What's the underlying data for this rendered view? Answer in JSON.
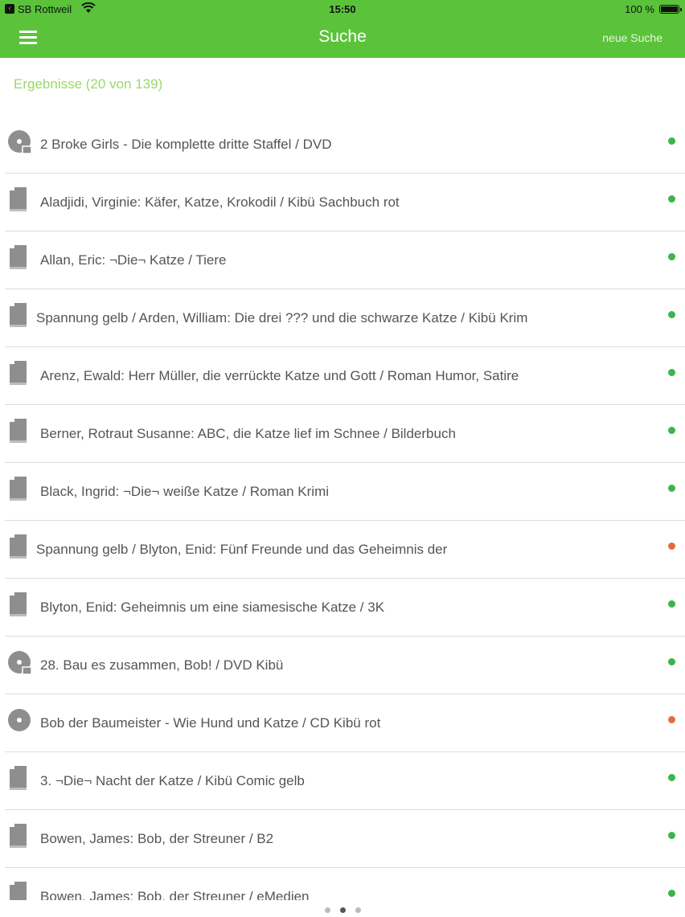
{
  "status_bar": {
    "carrier": "SB Rottweil",
    "time": "15:50",
    "battery": "100 %"
  },
  "nav": {
    "menu_icon": "hamburger-icon",
    "title": "Suche",
    "new_search": "neue Suche"
  },
  "results": {
    "count_label": "Ergebnisse (20 von 139)"
  },
  "colors": {
    "brand_green": "#5ac33a",
    "available": "#3cb54a",
    "unavailable": "#e86a3c"
  },
  "items": [
    {
      "icon": "disc-video-icon",
      "title": "2 Broke Girls - Die komplette dritte Staffel / DVD",
      "status": "available"
    },
    {
      "icon": "book-icon",
      "title": "Aladjidi, Virginie: Käfer, Katze, Krokodil / Kibü Sachbuch rot",
      "status": "available"
    },
    {
      "icon": "book-icon",
      "title": "Allan, Eric: ¬Die¬ Katze / Tiere",
      "status": "available"
    },
    {
      "icon": "book-icon",
      "title": "Spannung gelb / Arden, William: Die drei ??? und die schwarze Katze / Kibü Krim",
      "status": "available"
    },
    {
      "icon": "book-icon",
      "title": "Arenz, Ewald: Herr Müller, die verrückte Katze und Gott / Roman Humor, Satire",
      "status": "available"
    },
    {
      "icon": "book-icon",
      "title": "Berner, Rotraut Susanne: ABC, die Katze lief im Schnee / Bilderbuch",
      "status": "available"
    },
    {
      "icon": "book-icon",
      "title": "Black, Ingrid: ¬Die¬ weiße Katze / Roman Krimi",
      "status": "available"
    },
    {
      "icon": "book-icon",
      "title": "Spannung gelb / Blyton, Enid: Fünf Freunde und das Geheimnis der",
      "status": "unavailable"
    },
    {
      "icon": "book-icon",
      "title": "Blyton, Enid: Geheimnis um eine siamesische Katze / 3K",
      "status": "available"
    },
    {
      "icon": "disc-video-icon",
      "title": "28. Bau es zusammen, Bob! / DVD Kibü",
      "status": "available"
    },
    {
      "icon": "disc-icon",
      "title": "Bob der Baumeister - Wie Hund und Katze / CD Kibü rot",
      "status": "unavailable"
    },
    {
      "icon": "book-icon",
      "title": "3. ¬Die¬ Nacht der Katze / Kibü Comic gelb",
      "status": "available"
    },
    {
      "icon": "book-icon",
      "title": "Bowen, James: Bob, der Streuner / B2",
      "status": "available"
    },
    {
      "icon": "book-icon",
      "title": "Bowen, James: Bob, der Streuner / eMedien",
      "status": "available"
    }
  ],
  "pager": {
    "pages": 3,
    "active": 2
  }
}
